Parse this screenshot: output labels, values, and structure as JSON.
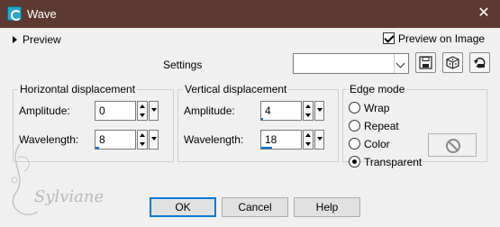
{
  "window": {
    "title": "Wave",
    "close_glyph": "✕"
  },
  "preview": {
    "toggle_label": "Preview",
    "preview_on_image_label": "Preview on Image",
    "preview_on_image_checked": true
  },
  "settings": {
    "label": "Settings",
    "current_value": ""
  },
  "horizontal": {
    "legend": "Horizontal displacement",
    "amplitude_label": "Amplitude:",
    "amplitude_value": "0",
    "wavelength_label": "Wavelength:",
    "wavelength_value": "8"
  },
  "vertical": {
    "legend": "Vertical displacement",
    "amplitude_label": "Amplitude:",
    "amplitude_value": "4",
    "wavelength_label": "Wavelength:",
    "wavelength_value": "18"
  },
  "edge_mode": {
    "legend": "Edge mode",
    "options": [
      "Wrap",
      "Repeat",
      "Color",
      "Transparent"
    ],
    "selected": "Transparent"
  },
  "buttons": {
    "ok": "OK",
    "cancel": "Cancel",
    "help": "Help"
  },
  "watermark": {
    "text": "Sylviane"
  },
  "colors": {
    "titlebar": "#5d3a31",
    "accent": "#0078d7"
  }
}
